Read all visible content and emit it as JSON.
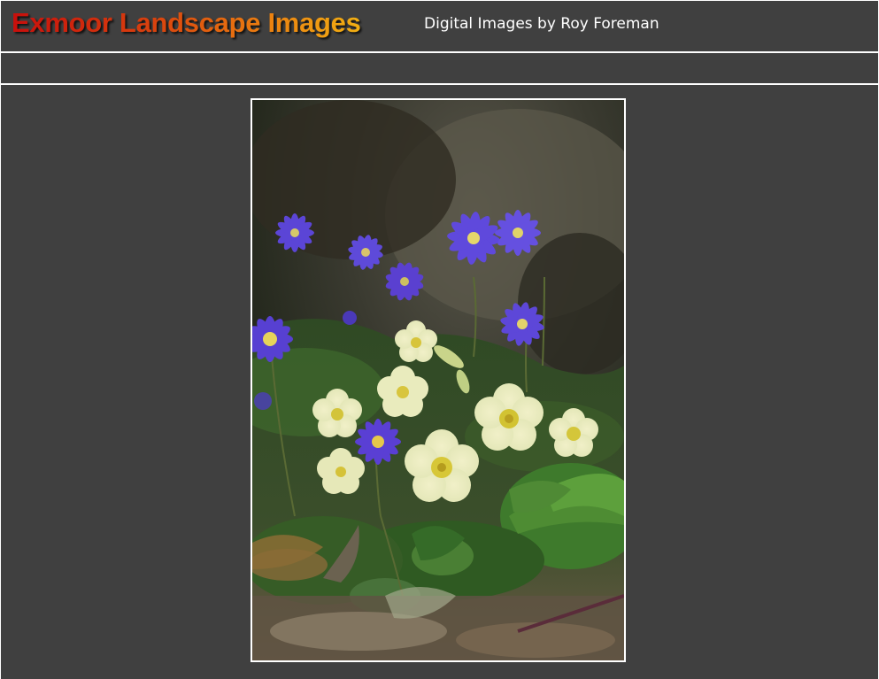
{
  "header": {
    "title": "Exmoor Landscape Images",
    "subtitle": "Digital Images by Roy Foreman"
  },
  "photo": {
    "subject": "primrose-and-anemone-flowers"
  },
  "colors": {
    "page_background": "#404040",
    "rule": "#ffffff",
    "title_gradient": [
      "#c80f0c",
      "#ea7a10",
      "#f2b013"
    ],
    "subtitle": "#ffffff"
  }
}
